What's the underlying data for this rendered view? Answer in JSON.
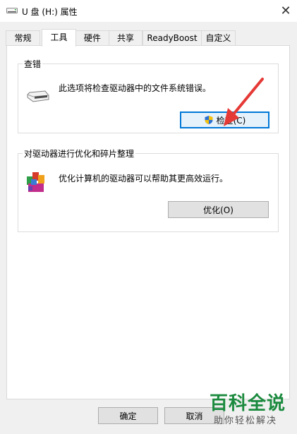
{
  "window": {
    "title": "U 盘 (H:) 属性",
    "close_glyph": "✕"
  },
  "tabs": [
    {
      "label": "常规"
    },
    {
      "label": "工具"
    },
    {
      "label": "硬件"
    },
    {
      "label": "共享"
    },
    {
      "label": "ReadyBoost"
    },
    {
      "label": "自定义"
    }
  ],
  "active_tab": "工具",
  "error_check": {
    "title": "查错",
    "description": "此选项将检查驱动器中的文件系统错误。",
    "button_label": "检查(C)"
  },
  "optimize": {
    "title": "对驱动器进行优化和碎片整理",
    "description": "优化计算机的驱动器可以帮助其更高效运行。",
    "button_label": "优化(O)"
  },
  "footer": {
    "ok_label": "确定",
    "cancel_label": "取消"
  },
  "watermark": {
    "brand": "百科全说",
    "slogan": "助你轻松解决"
  },
  "colors": {
    "accent": "#0078d7",
    "arrow": "#e53935",
    "watermark": "#1b8a3e"
  }
}
